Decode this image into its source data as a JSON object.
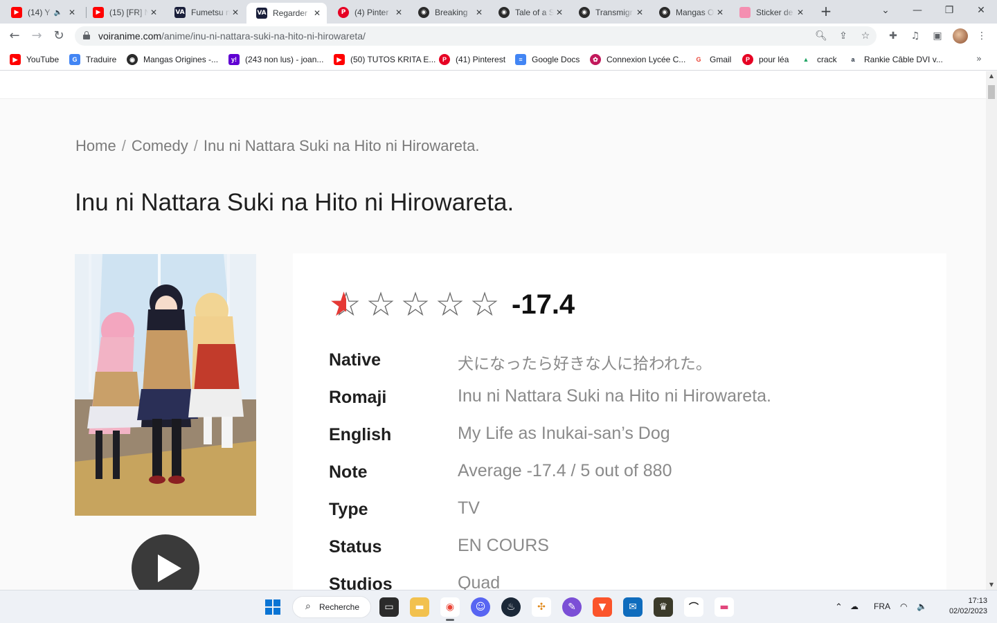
{
  "browser": {
    "tabs": [
      {
        "title": "(14) Y",
        "icon": "youtube-icon",
        "color": "#ff0000"
      },
      {
        "title": "(15) [FR] N",
        "icon": "youtube-icon",
        "color": "#ff0000"
      },
      {
        "title": "Fumetsu n",
        "icon": "voiranime-icon",
        "color": "#1a1f3a"
      },
      {
        "title": "Regarder",
        "icon": "voiranime-icon",
        "color": "#1a1f3a"
      },
      {
        "title": "(4) Pinter",
        "icon": "pinterest-icon",
        "color": "#e60023"
      },
      {
        "title": "Breaking ",
        "icon": "manga-icon",
        "color": "#2b2b2b"
      },
      {
        "title": "Tale of a S",
        "icon": "manga-icon",
        "color": "#2b2b2b"
      },
      {
        "title": "Transmigr",
        "icon": "manga-icon",
        "color": "#2b2b2b"
      },
      {
        "title": "Mangas O",
        "icon": "manga-icon",
        "color": "#2b2b2b"
      },
      {
        "title": "Sticker de",
        "icon": "sticker-icon",
        "color": "#f48fb1"
      }
    ],
    "address": {
      "host": "voiranime.com",
      "path": "/anime/inu-ni-nattara-suki-na-hito-ni-hirowareta/"
    },
    "bookmarks": [
      {
        "label": "YouTube",
        "icon": "youtube-icon",
        "color": "#ff0000"
      },
      {
        "label": "Traduire",
        "icon": "translate-icon",
        "color": "#4285f4"
      },
      {
        "label": "Mangas Origines -...",
        "icon": "manga-icon",
        "color": "#2b2b2b"
      },
      {
        "label": "(243 non lus) - joan...",
        "icon": "yahoo-icon",
        "color": "#6001d2"
      },
      {
        "label": "(50) TUTOS KRITA E...",
        "icon": "youtube-icon",
        "color": "#ff0000"
      },
      {
        "label": "(41) Pinterest",
        "icon": "pinterest-icon",
        "color": "#e60023"
      },
      {
        "label": "Google Docs",
        "icon": "docs-icon",
        "color": "#4285f4"
      },
      {
        "label": "Connexion Lycée C...",
        "icon": "lycee-icon",
        "color": "#c2185b"
      },
      {
        "label": "Gmail",
        "icon": "google-icon",
        "color": "#ea4335"
      },
      {
        "label": "pour léa",
        "icon": "pinterest-icon",
        "color": "#e60023"
      },
      {
        "label": "crack",
        "icon": "drive-icon",
        "color": "#1fa463"
      },
      {
        "label": "Rankie Câble DVI v...",
        "icon": "amazon-icon",
        "color": "#232f3e"
      }
    ]
  },
  "page": {
    "breadcrumb": {
      "home": "Home",
      "sep": "/",
      "category": "Comedy",
      "current": "Inu ni Nattara Suki na Hito ni Hirowareta."
    },
    "title": "Inu ni Nattara Suki na Hito ni Hirowareta.",
    "rating": {
      "stars_filled_fraction": 0.1,
      "score": "-17.4",
      "star_char": "☆",
      "star_fill_char": "★"
    },
    "fields": [
      {
        "label": "Native",
        "value": "犬になったら好きな人に拾われた。"
      },
      {
        "label": "Romaji",
        "value": "Inu ni Nattara Suki na Hito ni Hirowareta."
      },
      {
        "label": "English",
        "value": "My Life as Inukai-san’s Dog"
      },
      {
        "label": "Note",
        "value": "Average -17.4 / 5 out of 880"
      },
      {
        "label": "Type",
        "value": "TV"
      },
      {
        "label": "Status",
        "value": "EN COURS"
      },
      {
        "label": "Studios",
        "value": "Quad"
      }
    ]
  },
  "taskbar": {
    "search_label": "Recherche",
    "language": "FRA",
    "time": "17:13",
    "date": "02/02/2023"
  }
}
